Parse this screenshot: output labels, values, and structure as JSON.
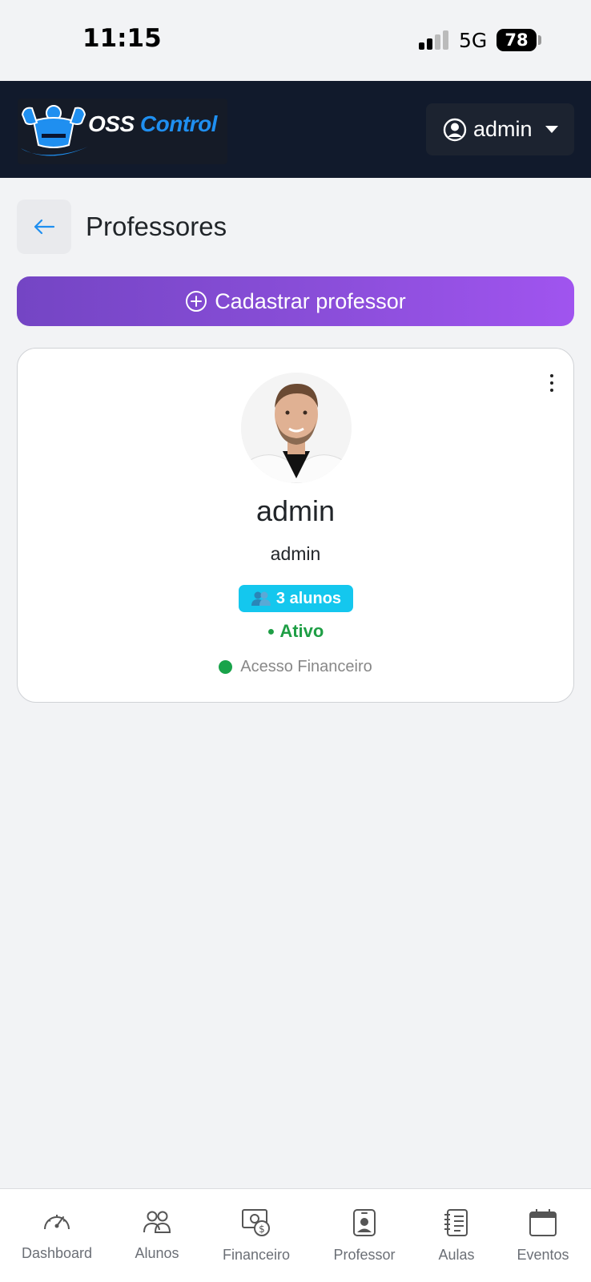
{
  "status_bar": {
    "time": "11:15",
    "network": "5G",
    "battery": "78"
  },
  "header": {
    "logo_text_white": "OSS ",
    "logo_text_blue": "Control",
    "user_menu_label": "admin"
  },
  "page": {
    "title": "Professores"
  },
  "add_button": {
    "label": "Cadastrar professor"
  },
  "professor_card": {
    "name": "admin",
    "username": "admin",
    "students_badge": "3 alunos",
    "status": "Ativo",
    "financial_access": "Acesso Financeiro"
  },
  "bottom_nav": {
    "items": [
      {
        "label": "Dashboard",
        "icon": "speedometer-icon"
      },
      {
        "label": "Alunos",
        "icon": "people-icon"
      },
      {
        "label": "Financeiro",
        "icon": "cash-icon"
      },
      {
        "label": "Professor",
        "icon": "person-badge-icon"
      },
      {
        "label": "Aulas",
        "icon": "journal-icon"
      },
      {
        "label": "Eventos",
        "icon": "calendar-icon"
      }
    ]
  },
  "colors": {
    "navbar": "#111a2c",
    "primary_gradient_start": "#7445c4",
    "primary_gradient_end": "#a054ef",
    "badge": "#14c7ee",
    "active_green": "#1e9e45"
  }
}
